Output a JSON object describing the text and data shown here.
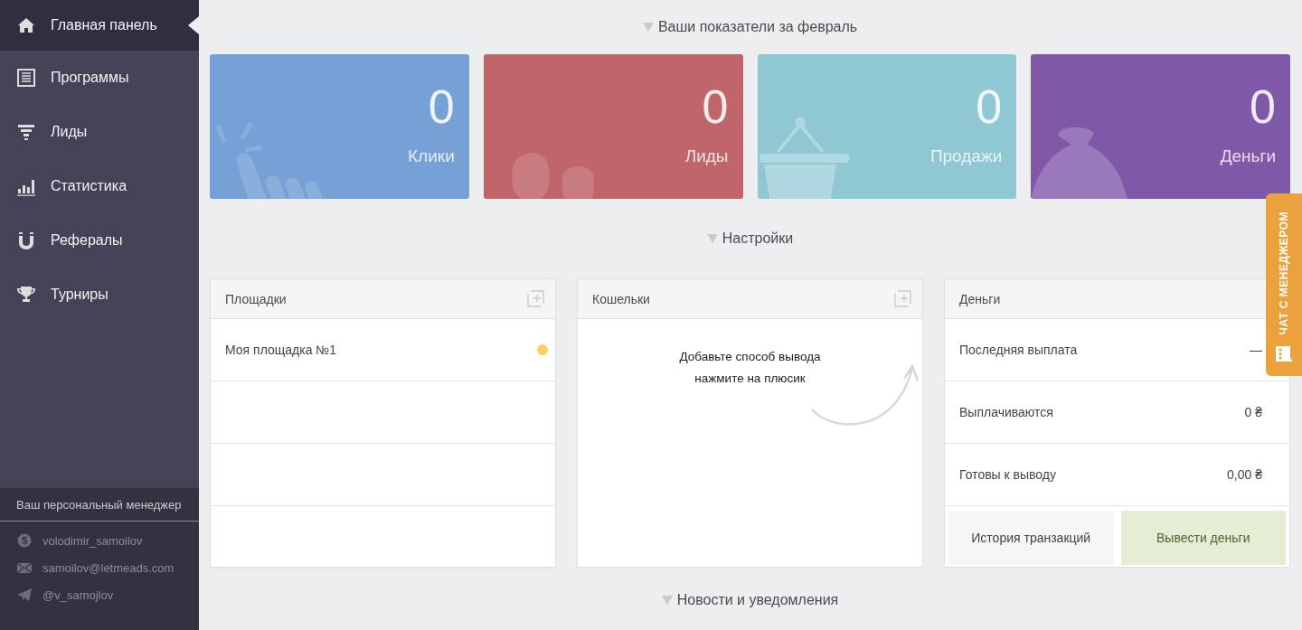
{
  "sidebar": {
    "items": [
      {
        "label": "Главная панель",
        "kind": "home",
        "selected": true
      },
      {
        "label": "Программы",
        "kind": "list",
        "selected": false
      },
      {
        "label": "Лиды",
        "kind": "funnel",
        "selected": false
      },
      {
        "label": "Статистика",
        "kind": "chart",
        "selected": false
      },
      {
        "label": "Рефералы",
        "kind": "magnet",
        "selected": false
      },
      {
        "label": "Турниры",
        "kind": "trophy",
        "selected": false
      }
    ],
    "manager": {
      "title": "Ваш персональный менеджер",
      "contacts": [
        {
          "kind": "skype",
          "text": "volodimir_samoilov"
        },
        {
          "kind": "email",
          "text": "samoilov@letmeads.com"
        },
        {
          "kind": "telegram",
          "text": "@v_samojlov"
        }
      ]
    }
  },
  "stats": {
    "heading": "Ваши показатели за февраль",
    "cards": [
      {
        "kind": "clicks",
        "value": "0",
        "label": "Клики",
        "color": "#76a1d6"
      },
      {
        "kind": "leads",
        "value": "0",
        "label": "Лиды",
        "color": "#c0666a"
      },
      {
        "kind": "sales",
        "value": "0",
        "label": "Продажи",
        "color": "#8fc7d3"
      },
      {
        "kind": "money",
        "value": "0",
        "label": "Деньги",
        "color": "#7f58a8"
      }
    ]
  },
  "settings": {
    "heading": "Настройки",
    "sites": {
      "title": "Площадки",
      "rows": [
        {
          "name": "Моя площадка №1",
          "color": "#f7d35e"
        }
      ]
    },
    "wallets": {
      "title": "Кошельки",
      "hint_lines": [
        "Добавьте способ вывода",
        "нажмите на плюсик"
      ]
    },
    "money": {
      "title": "Деньги",
      "rows": [
        {
          "label": "Последняя выплата",
          "value": "—"
        },
        {
          "label": "Выплачиваются",
          "value": "0 ₴"
        },
        {
          "label": "Готовы к выводу",
          "value": "0,00 ₴"
        }
      ],
      "buttons": [
        {
          "label": "История транзакций",
          "kind": "secondary"
        },
        {
          "label": "Вывести деньги",
          "kind": "primary"
        }
      ]
    }
  },
  "news": {
    "heading": "Новости и уведомления"
  },
  "chat_tab": {
    "label": "ЧАТ С МЕНЕДЖЕРОМ"
  }
}
